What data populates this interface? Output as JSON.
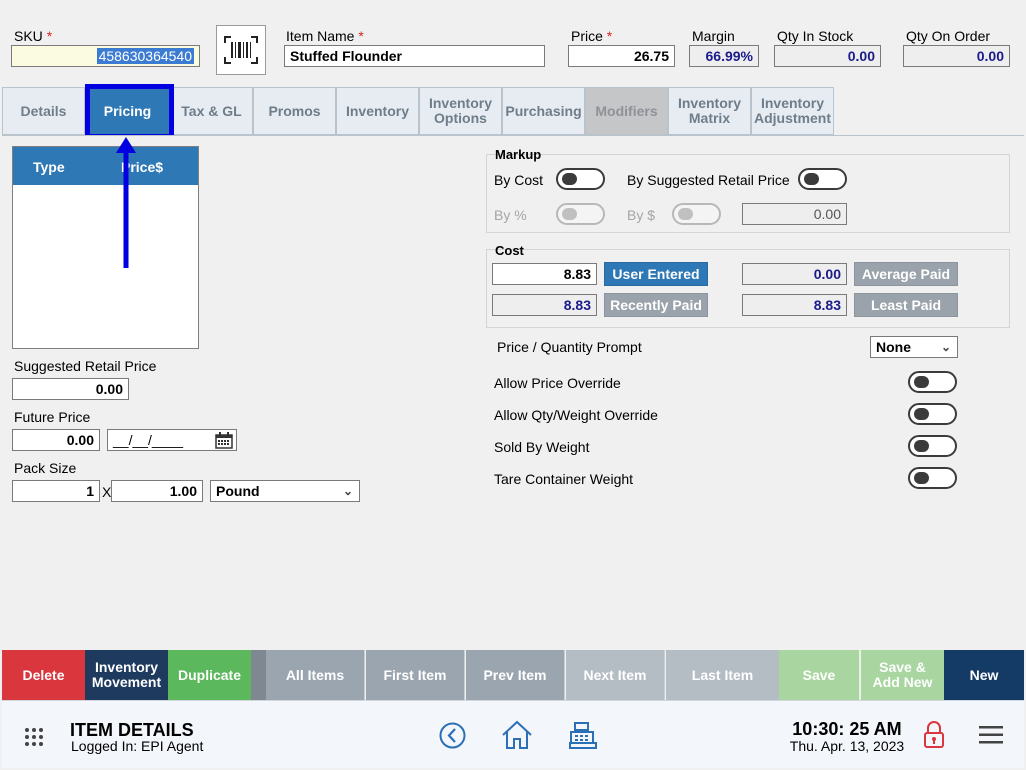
{
  "header": {
    "sku_label": "SKU",
    "required_mark": "*",
    "sku_value": "458630364540",
    "item_name_label": "Item Name",
    "item_name_value": "Stuffed Flounder",
    "price_label": "Price",
    "price_value": "26.75",
    "margin_label": "Margin",
    "margin_value": "66.99%",
    "qty_in_stock_label": "Qty In Stock",
    "qty_in_stock_value": "0.00",
    "qty_on_order_label": "Qty On Order",
    "qty_on_order_value": "0.00",
    "scan_icon": "barcode-icon"
  },
  "tabs": [
    {
      "label": "Details"
    },
    {
      "label": "Pricing",
      "active": true
    },
    {
      "label": "Tax & GL"
    },
    {
      "label": "Promos"
    },
    {
      "label": "Inventory"
    },
    {
      "label": "Inventory\nOptions"
    },
    {
      "label": "Purchasing"
    },
    {
      "label": "Modifiers",
      "disabled": true
    },
    {
      "label": "Inventory\nMatrix"
    },
    {
      "label": "Inventory\nAdjustment"
    }
  ],
  "price_table": {
    "columns": [
      "Type",
      "Price$"
    ],
    "rows": []
  },
  "left": {
    "suggested_retail_label": "Suggested Retail Price",
    "suggested_retail_value": "0.00",
    "future_price_label": "Future Price",
    "future_price_value": "0.00",
    "future_date_value": "__/__/____",
    "pack_size_label": "Pack Size",
    "pack_qty": "1",
    "pack_x": "X",
    "pack_amount": "1.00",
    "pack_unit": "Pound"
  },
  "markup": {
    "title": "Markup",
    "by_cost_label": "By Cost",
    "by_srp_label": "By Suggested Retail Price",
    "by_pct_label": "By %",
    "by_dollar_label": "By $",
    "value": "0.00"
  },
  "cost": {
    "title": "Cost",
    "user_entered_value": "8.83",
    "user_entered_button": "User Entered",
    "recently_paid_value": "8.83",
    "recently_paid_button": "Recently Paid",
    "average_paid_value": "0.00",
    "average_paid_button": "Average Paid",
    "least_paid_value": "8.83",
    "least_paid_button": "Least Paid"
  },
  "options": {
    "price_qty_prompt_label": "Price / Quantity Prompt",
    "price_qty_prompt_value": "None",
    "allow_price_override_label": "Allow Price Override",
    "allow_qty_weight_override_label": "Allow Qty/Weight Override",
    "sold_by_weight_label": "Sold By Weight",
    "tare_container_weight_label": "Tare Container Weight"
  },
  "actions": [
    {
      "label": "Delete",
      "color": "#d9363e"
    },
    {
      "label": "Inventory\nMovement",
      "color": "#1e3a5f"
    },
    {
      "label": "Duplicate",
      "color": "#5cb85c"
    },
    {
      "label": "All Items",
      "color": "#9aa5b0"
    },
    {
      "label": "First Item",
      "color": "#9aa5b0"
    },
    {
      "label": "Prev Item",
      "color": "#9aa5b0"
    },
    {
      "label": "Next Item",
      "color": "#b4bcc4"
    },
    {
      "label": "Last Item",
      "color": "#b4bcc4"
    },
    {
      "label": "Save",
      "color": "#a8d5a0"
    },
    {
      "label": "Save &\nAdd New",
      "color": "#a8d5a0"
    },
    {
      "label": "New",
      "color": "#143a66"
    }
  ],
  "footer": {
    "title": "ITEM DETAILS",
    "logged_in": "Logged In:  EPI Agent",
    "time": "10:30: 25 AM",
    "date": "Thu. Apr. 13, 2023"
  }
}
